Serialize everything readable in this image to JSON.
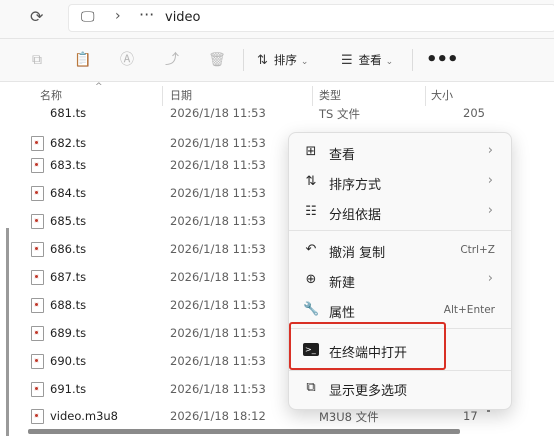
{
  "address": {
    "refresh_icon": "refresh-icon",
    "location_icon": "monitor-icon",
    "overflow": "···",
    "crumb": "video"
  },
  "toolbar": {
    "sort_label": "排序",
    "view_label": "查看",
    "more": "•••"
  },
  "columns": {
    "name": "名称",
    "date": "日期",
    "type": "类型",
    "size": "大小"
  },
  "files": [
    {
      "name": "681.ts",
      "date": "2026/1/18 11:53",
      "type": "TS 文件",
      "size": "205"
    },
    {
      "name": "682.ts",
      "date": "2026/1/18 11:53"
    },
    {
      "name": "683.ts",
      "date": "2026/1/18 11:53"
    },
    {
      "name": "684.ts",
      "date": "2026/1/18 11:53"
    },
    {
      "name": "685.ts",
      "date": "2026/1/18 11:53"
    },
    {
      "name": "686.ts",
      "date": "2026/1/18 11:53"
    },
    {
      "name": "687.ts",
      "date": "2026/1/18 11:53"
    },
    {
      "name": "688.ts",
      "date": "2026/1/18 11:53"
    },
    {
      "name": "689.ts",
      "date": "2026/1/18 11:53"
    },
    {
      "name": "690.ts",
      "date": "2026/1/18 11:53"
    },
    {
      "name": "691.ts",
      "date": "2026/1/18 11:53"
    },
    {
      "name": "video.m3u8",
      "date": "2026/1/18 18:12",
      "type": "M3U8 文件",
      "size": "17"
    }
  ],
  "context_menu": {
    "view": "查看",
    "sort_by": "排序方式",
    "group_by": "分组依据",
    "undo_copy": "撤消 复制",
    "undo_shortcut": "Ctrl+Z",
    "new": "新建",
    "properties": "属性",
    "properties_shortcut": "Alt+Enter",
    "open_terminal": "在终端中打开",
    "show_more": "显示更多选项"
  },
  "colors": {
    "highlight_border": "#d93025",
    "menu_bg": "#f9f9f9"
  }
}
